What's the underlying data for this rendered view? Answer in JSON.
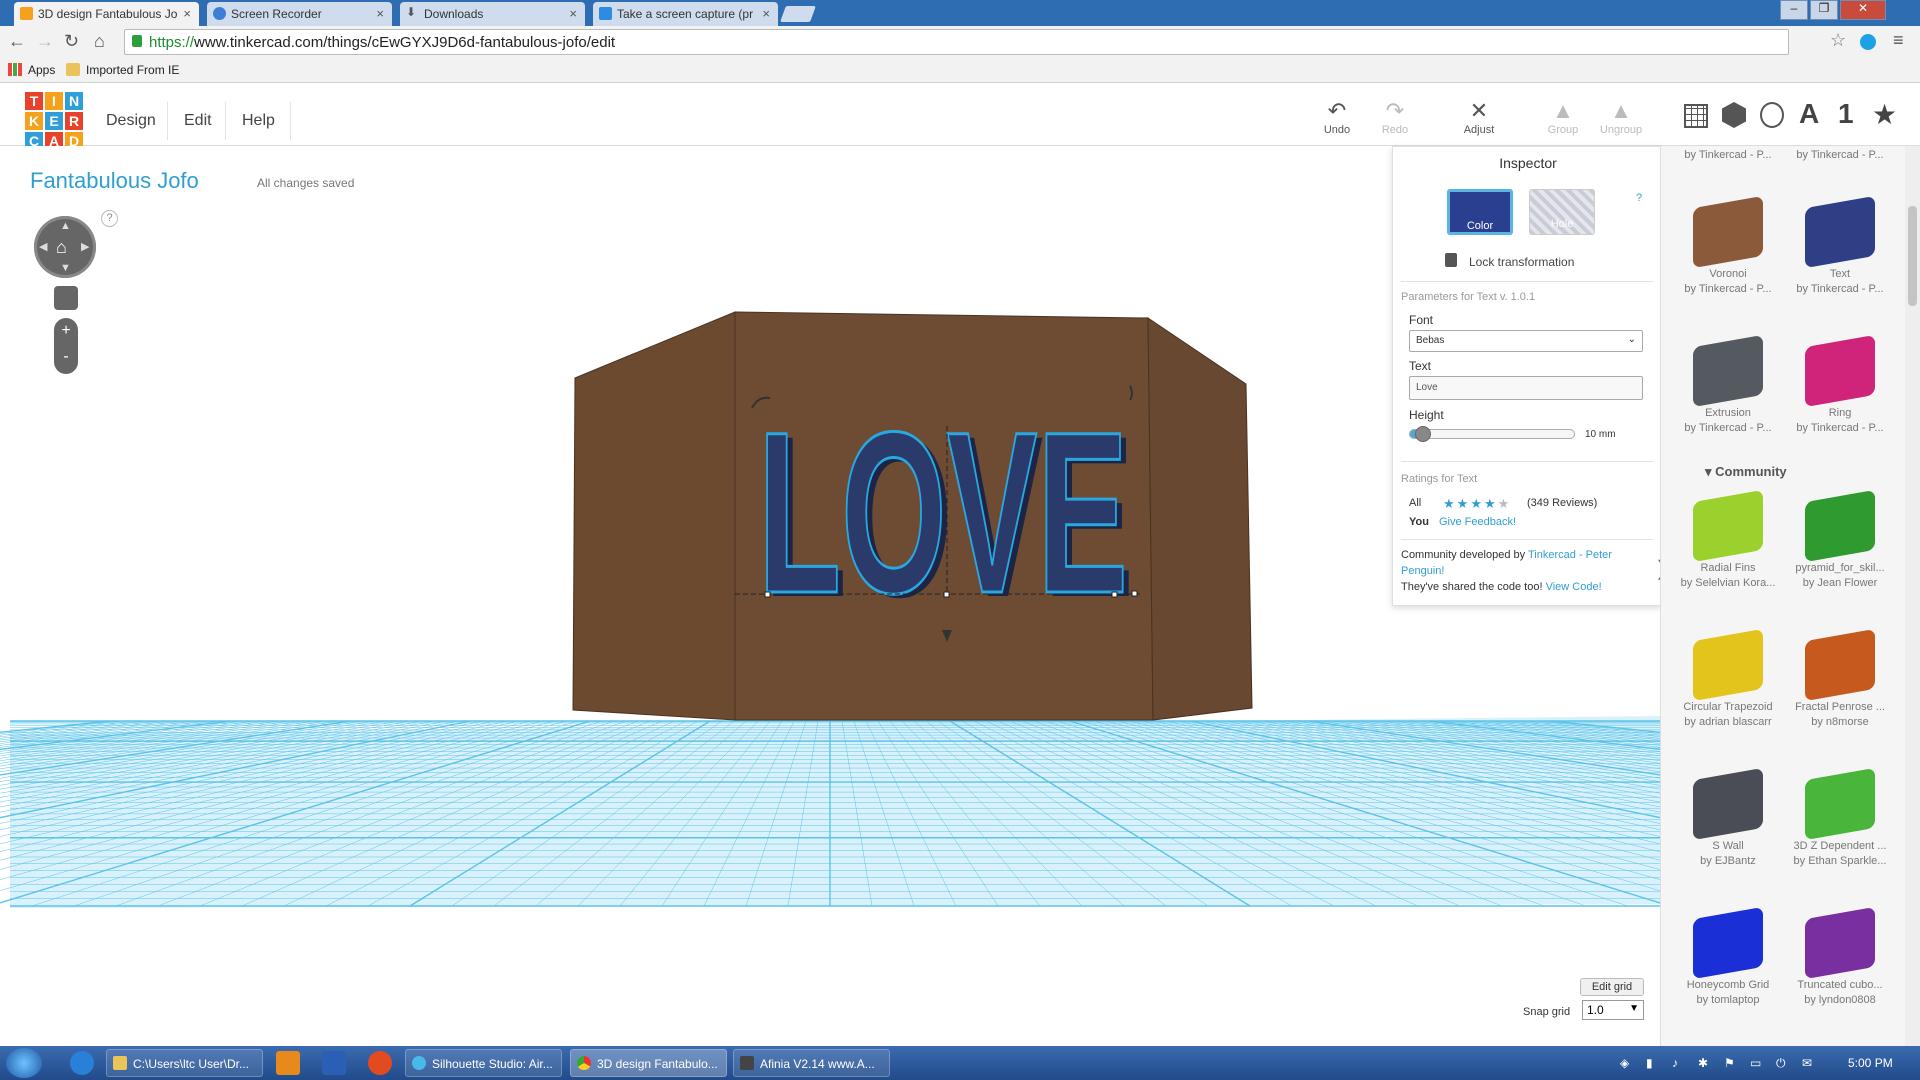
{
  "browser": {
    "tabs": [
      {
        "title": "3D design Fantabulous Jo",
        "active": true
      },
      {
        "title": "Screen Recorder",
        "active": false
      },
      {
        "title": "Downloads",
        "active": false
      },
      {
        "title": "Take a screen capture (pr",
        "active": false
      }
    ],
    "url_scheme": "https://",
    "url_rest": "www.tinkercad.com/things/cEwGYXJ9D6d-fantabulous-jofo/edit",
    "bookmarks": [
      "Apps",
      "Imported From IE"
    ]
  },
  "header": {
    "logo_letters": [
      "T",
      "I",
      "N",
      "K",
      "E",
      "R",
      "C",
      "A",
      "D"
    ],
    "logo_colors": [
      "#e8412c",
      "#f7a11a",
      "#2e9fd9",
      "#f7a11a",
      "#2e9fd9",
      "#e8412c",
      "#2e9fd9",
      "#e8412c",
      "#f7a11a"
    ],
    "menu": [
      "Design",
      "Edit",
      "Help"
    ],
    "tools": [
      {
        "label": "Undo",
        "icon": "undo-icon",
        "enabled": true
      },
      {
        "label": "Redo",
        "icon": "redo-icon",
        "enabled": false
      },
      {
        "label": "Adjust",
        "icon": "adjust-icon",
        "enabled": true
      },
      {
        "label": "Group",
        "icon": "group-icon",
        "enabled": false
      },
      {
        "label": "Ungroup",
        "icon": "ungroup-icon",
        "enabled": false
      }
    ],
    "view_icons": [
      "grid-icon",
      "box-icon",
      "wireframe-icon",
      "text-icon",
      "number-icon",
      "star-icon"
    ],
    "view_glyphs": [
      "A",
      "1",
      "★"
    ]
  },
  "design": {
    "name": "Fantabulous Jofo",
    "status": "All changes saved",
    "nav_help": "?",
    "zoom_in": "+",
    "zoom_out": "-"
  },
  "scene": {
    "text": "LOVE",
    "text_color": "#2a3a6b",
    "outline_color": "#29a8e0",
    "box_color": "#6b4a30",
    "grid_color": "#5cc3e8"
  },
  "inspector": {
    "title": "Inspector",
    "color_label": "Color",
    "hole_label": "Hole",
    "help": "?",
    "lock_label": "Lock transformation",
    "params_title": "Parameters for Text v. 1.0.1",
    "font_label": "Font",
    "font_value": "Bebas",
    "text_label": "Text",
    "text_value": "Love",
    "height_label": "Height",
    "height_value": "10 mm",
    "height_fraction": 0.03,
    "ratings_title": "Ratings for Text",
    "rating_all_label": "All",
    "rating_stars": 4,
    "rating_reviews": "(349 Reviews)",
    "rating_you_label": "You",
    "give_feedback": "Give Feedback!",
    "community_prefix": "Community developed by ",
    "community_link": "Tinkercad - Peter Penguin!",
    "shared_prefix": "They've shared the code too! ",
    "view_code": "View Code!"
  },
  "grid_controls": {
    "edit_grid": "Edit grid",
    "snap_label": "Snap grid",
    "snap_value": "1.0"
  },
  "shapes": {
    "top_partial": [
      {
        "author": "by Tinkercad - P..."
      },
      {
        "author": "by Tinkercad - P..."
      }
    ],
    "items": [
      {
        "name": "Voronoi",
        "author": "by Tinkercad - P...",
        "color": "#8a5a3a"
      },
      {
        "name": "Text",
        "author": "by Tinkercad - P...",
        "color": "#2e3f86"
      },
      {
        "name": "Extrusion",
        "author": "by Tinkercad - P...",
        "color": "#555a60"
      },
      {
        "name": "Ring",
        "author": "by Tinkercad - P...",
        "color": "#d0237a"
      }
    ],
    "community_header": "Community",
    "community": [
      {
        "name": "Radial Fins",
        "author": "by Selelvian Kora...",
        "color": "#9bd12c"
      },
      {
        "name": "pyramid_for_skil...",
        "author": "by Jean Flower",
        "color": "#2f9a2f"
      },
      {
        "name": "Circular Trapezoid",
        "author": "by adrian blascarr",
        "color": "#e3c41c"
      },
      {
        "name": "Fractal Penrose ...",
        "author": "by n8morse",
        "color": "#c65a1e"
      },
      {
        "name": "S Wall",
        "author": "by EJBantz",
        "color": "#4a4d55"
      },
      {
        "name": "3D Z Dependent ...",
        "author": "by Ethan Sparkle...",
        "color": "#49b53a"
      },
      {
        "name": "Honeycomb Grid",
        "author": "by tomlaptop",
        "color": "#1b2fd6"
      },
      {
        "name": "Truncated cubo...",
        "author": "by lyndon0808",
        "color": "#7a2fa0"
      }
    ]
  },
  "taskbar": {
    "tasks": [
      {
        "label": "C:\\Users\\ltc User\\Dr...",
        "active": false
      },
      {
        "label": "Silhouette Studio: Air...",
        "active": false
      },
      {
        "label": "3D design Fantabulo...",
        "active": true
      },
      {
        "label": "Afinia  V2.14  www.A...",
        "active": false
      }
    ],
    "clock": "5:00 PM"
  }
}
